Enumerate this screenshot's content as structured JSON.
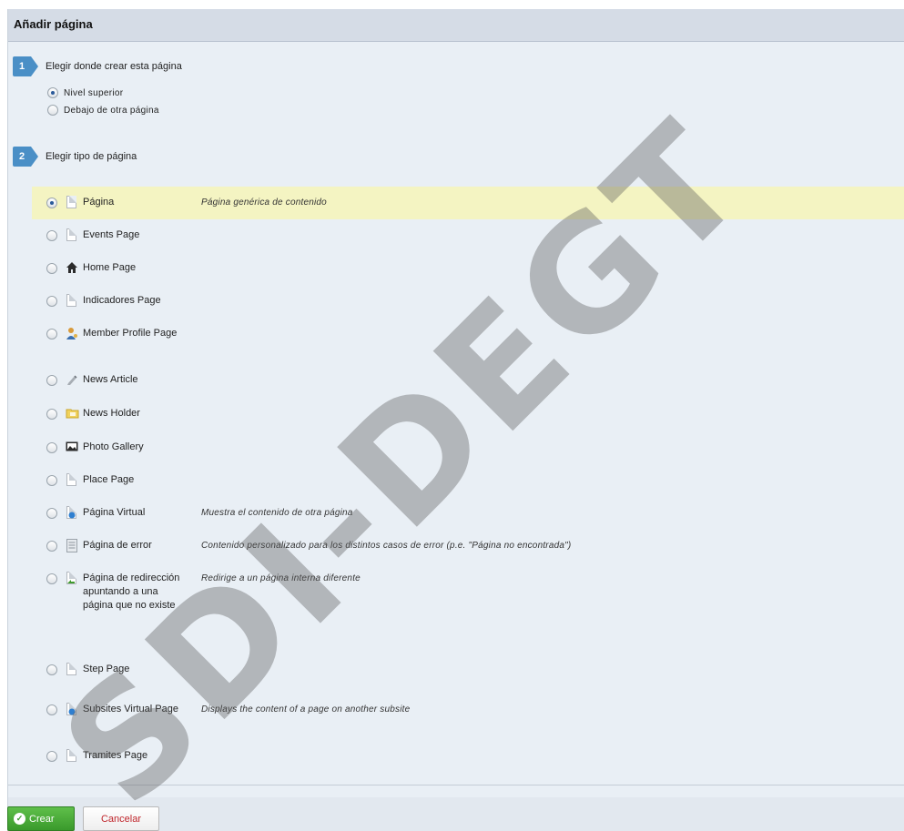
{
  "dialog": {
    "title": "Añadir página"
  },
  "step1": {
    "number": "1",
    "label": "Elegir donde crear esta página",
    "options": [
      {
        "label": "Nivel superior",
        "checked": true
      },
      {
        "label": "Debajo de otra página",
        "checked": false
      }
    ]
  },
  "step2": {
    "number": "2",
    "label": "Elegir tipo de página",
    "types": [
      {
        "name": "Página",
        "description": "Página genérica de contenido",
        "icon": "page-icon",
        "checked": true
      },
      {
        "name": "Events Page",
        "description": "",
        "icon": "page-icon",
        "checked": false
      },
      {
        "name": "Home Page",
        "description": "",
        "icon": "home-icon",
        "checked": false
      },
      {
        "name": "Indicadores Page",
        "description": "",
        "icon": "page-icon",
        "checked": false
      },
      {
        "name": "Member Profile Page",
        "description": "",
        "icon": "member-icon",
        "checked": false
      },
      {
        "name": "News Article",
        "description": "",
        "icon": "news-article-icon",
        "checked": false
      },
      {
        "name": "News Holder",
        "description": "",
        "icon": "folder-icon",
        "checked": false
      },
      {
        "name": "Photo Gallery",
        "description": "",
        "icon": "photo-icon",
        "checked": false
      },
      {
        "name": "Place Page",
        "description": "",
        "icon": "page-icon",
        "checked": false
      },
      {
        "name": "Página Virtual",
        "description": "Muestra el contenido de otra página",
        "icon": "virtual-page-icon",
        "checked": false
      },
      {
        "name": "Página de error",
        "description": "Contenido personalizado para los distintos casos de error (p.e. \"Página no encontrada\")",
        "icon": "error-page-icon",
        "checked": false
      },
      {
        "name": "Página de redirección apuntando a una página que no existe",
        "description": "Redirige a un página interna diferente",
        "icon": "redirect-icon",
        "checked": false
      },
      {
        "name": "Step Page",
        "description": "",
        "icon": "page-icon",
        "checked": false
      },
      {
        "name": "Subsites Virtual Page",
        "description": "Displays the content of a page on another subsite",
        "icon": "virtual-page-icon",
        "checked": false
      },
      {
        "name": "Tramites Page",
        "description": "",
        "icon": "page-icon",
        "checked": false
      }
    ]
  },
  "actions": {
    "create_label": "Crear",
    "cancel_label": "Cancelar"
  },
  "watermark": "SDI-DEGT",
  "colors": {
    "selected_row": "#f4f4c2",
    "step_badge": "#4a8fc6",
    "create_button": "#4aa83a",
    "cancel_text": "#c0262c"
  }
}
